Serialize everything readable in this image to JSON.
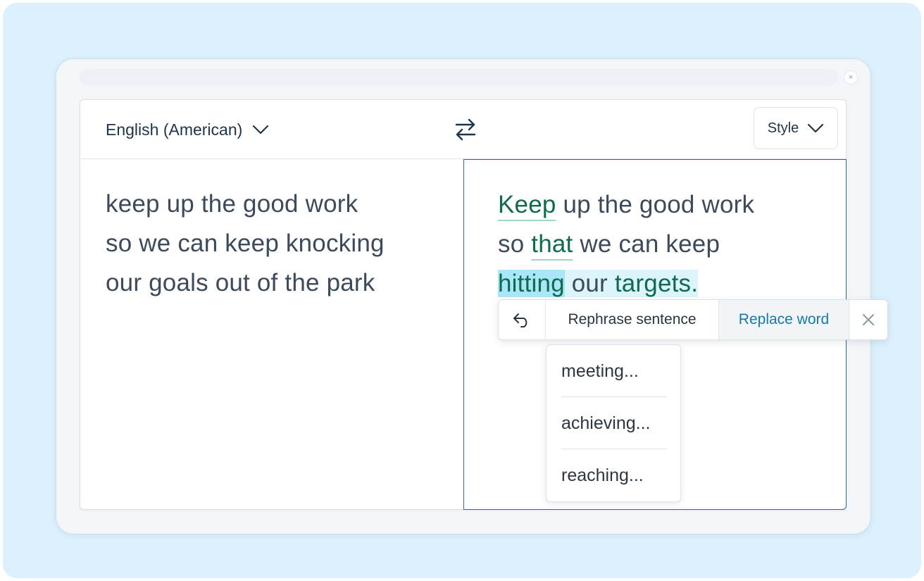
{
  "toolbar": {
    "language_label": "English (American)",
    "style_label": "Style"
  },
  "source": {
    "lines": [
      "keep up the good work",
      "so we can keep knocking",
      "our goals out of the park"
    ]
  },
  "result": {
    "line1": {
      "changed": "Keep",
      "rest": " up the good work"
    },
    "line2": {
      "pre": "so ",
      "changed": "that",
      "rest": " we can keep"
    },
    "line3": {
      "selected_word": "hitting",
      "mid": " our ",
      "changed": "targets."
    }
  },
  "popup": {
    "rephrase_label": "Rephrase sentence",
    "replace_label": "Replace word"
  },
  "suggestions": [
    "meeting...",
    "achieving...",
    "reaching..."
  ],
  "icons": {
    "window_close": "×",
    "undo": "undo-icon",
    "close": "close-icon",
    "swap": "swap-icon",
    "chevron": "chevron-down-icon"
  },
  "colors": {
    "changed_text": "#0f6a50",
    "accent_link": "#1479a8",
    "selection": "#a8e6f8",
    "backdrop": "#dcf1fc"
  }
}
